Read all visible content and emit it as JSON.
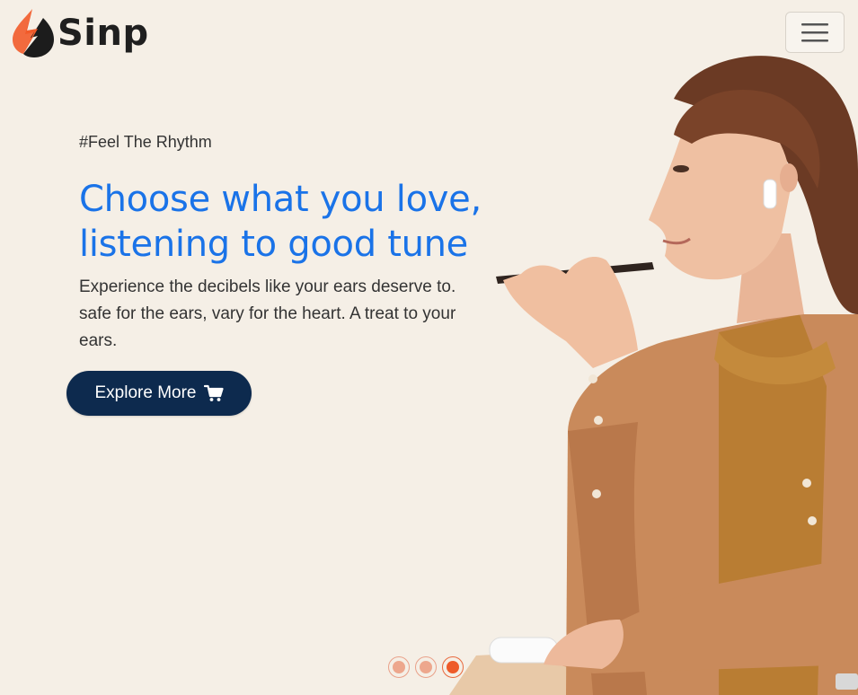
{
  "brand": {
    "name": "Sinp",
    "logo_icon": "lightning-drop-icon",
    "accent": "#f15a29"
  },
  "nav": {
    "menu_icon": "hamburger-icon"
  },
  "hero": {
    "tagline": "#Feel The Rhythm",
    "heading_line1": "Choose what you love,",
    "heading_line2": "listening to good tune",
    "description": "Experience the decibels like your ears deserve to. safe for the ears, vary for the heart. A treat to your ears.",
    "cta_label": "Explore More",
    "cta_icon": "cart-icon",
    "image": "woman-speaking-into-phone-wearing-earbuds"
  },
  "carousel": {
    "slides": 3,
    "active_index": 2
  },
  "colors": {
    "background": "#f5efe6",
    "heading": "#1a73e8",
    "button": "#0d2a4e",
    "indicator": "#ee5b2a"
  }
}
